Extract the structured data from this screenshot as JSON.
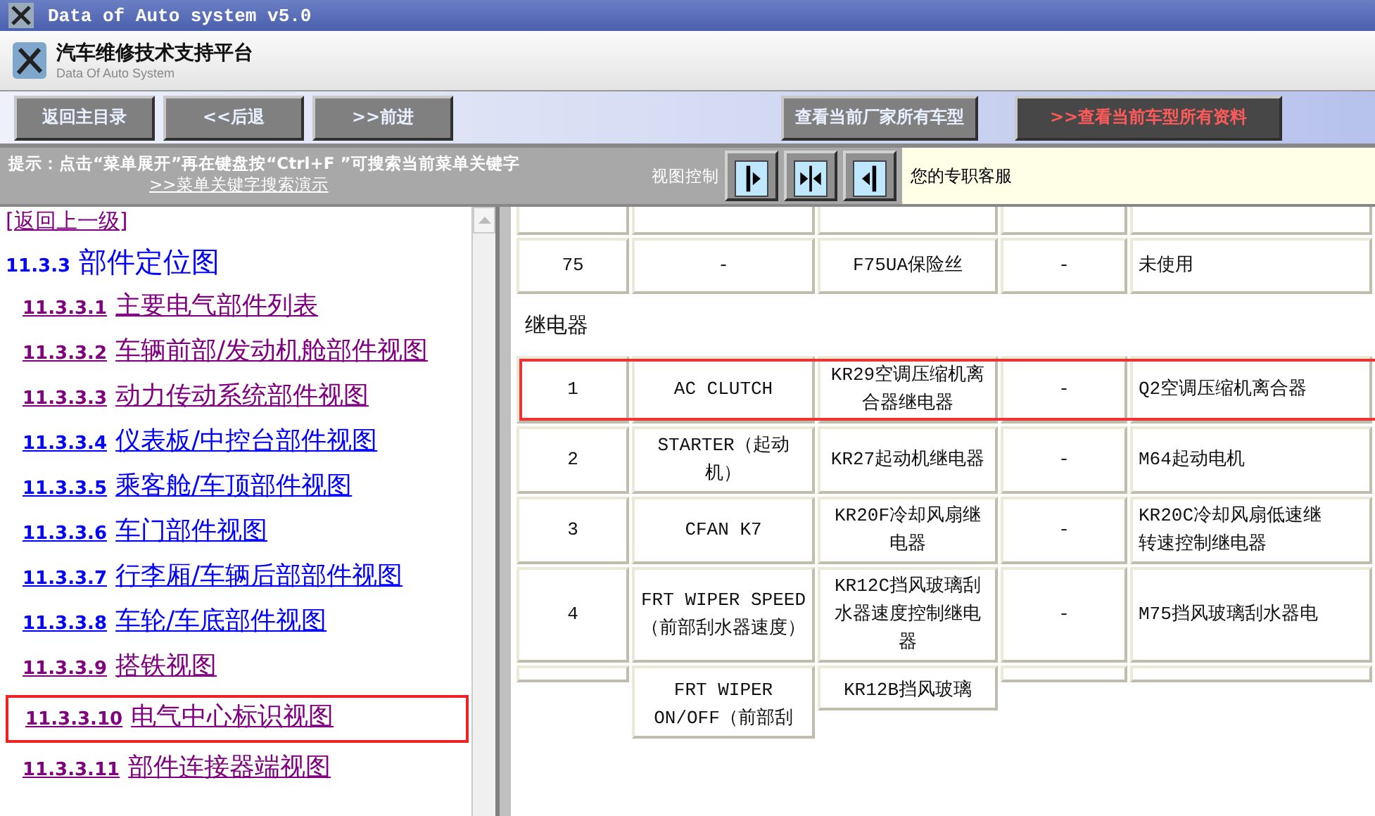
{
  "window": {
    "title": "Data of Auto system v5.0"
  },
  "header": {
    "title": "汽车维修技术支持平台",
    "subtitle": "Data Of Auto System"
  },
  "toolbar": {
    "buttons": [
      {
        "label": "返回主目录"
      },
      {
        "label": "<<后退"
      },
      {
        "label": ">>前进"
      }
    ],
    "right_buttons": [
      {
        "label": "查看当前厂家所有车型",
        "kind": "plain"
      },
      {
        "label": ">>查看当前车型所有资料",
        "kind": "alert"
      }
    ]
  },
  "hint_bar": {
    "hint": "提示：点击“菜单展开”再在键盘按“Ctrl+F ”可搜索当前菜单关键字",
    "demo_link": ">>菜单关键字搜索演示",
    "view_control_label": "视图控制",
    "view_buttons": [
      {
        "kind": "right"
      },
      {
        "kind": "both"
      },
      {
        "kind": "left"
      }
    ],
    "service": "您的专职客服"
  },
  "sidebar": {
    "back_link": "[返回上一级]",
    "heading": {
      "number": "11.3.3",
      "title": "部件定位图"
    },
    "items": [
      {
        "number": "11.3.3.1",
        "title": "主要电气部件列表",
        "visited": true,
        "highlighted": false
      },
      {
        "number": "11.3.3.2",
        "title": "车辆前部/发动机舱部件视图",
        "visited": true,
        "highlighted": false
      },
      {
        "number": "11.3.3.3",
        "title": "动力传动系统部件视图",
        "visited": true,
        "highlighted": false
      },
      {
        "number": "11.3.3.4",
        "title": "仪表板/中控台部件视图",
        "visited": false,
        "highlighted": false
      },
      {
        "number": "11.3.3.5",
        "title": "乘客舱/车顶部件视图",
        "visited": false,
        "highlighted": false
      },
      {
        "number": "11.3.3.6",
        "title": "车门部件视图",
        "visited": false,
        "highlighted": false
      },
      {
        "number": "11.3.3.7",
        "title": "行李厢/车辆后部部件视图",
        "visited": false,
        "highlighted": false
      },
      {
        "number": "11.3.3.8",
        "title": "车轮/车底部件视图",
        "visited": false,
        "highlighted": false
      },
      {
        "number": "11.3.3.9",
        "title": "搭铁视图",
        "visited": true,
        "highlighted": false
      },
      {
        "number": "11.3.3.10",
        "title": "电气中心标识视图",
        "visited": true,
        "highlighted": true
      },
      {
        "number": "11.3.3.11",
        "title": "部件连接器端视图",
        "visited": true,
        "highlighted": false
      }
    ]
  },
  "table": {
    "rows": [
      {
        "kind": "partial",
        "cells": []
      },
      {
        "kind": "row",
        "highlighted": false,
        "cells": [
          "75",
          "-",
          "F75UA保险丝",
          "-",
          "未使用"
        ]
      },
      {
        "kind": "section",
        "title": "继电器"
      },
      {
        "kind": "row",
        "highlighted": true,
        "cells": [
          "1",
          "AC CLUTCH",
          "KR29空调压缩机离合器继电器",
          "-",
          "Q2空调压缩机离合器"
        ]
      },
      {
        "kind": "row",
        "highlighted": false,
        "cells": [
          "2",
          "STARTER（起动机）",
          "KR27起动机继电器",
          "-",
          "M64起动电机"
        ]
      },
      {
        "kind": "row",
        "highlighted": false,
        "cells": [
          "3",
          "CFAN K7",
          "KR20F冷却风扇继电器",
          "-",
          "KR20C冷却风扇低速继转速控制继电器"
        ]
      },
      {
        "kind": "row",
        "highlighted": false,
        "cells": [
          "4",
          "FRT WIPER SPEED（前部刮水器速度）",
          "KR12C挡风玻璃刮水器速度控制继电器",
          "-",
          "M75挡风玻璃刮水器电"
        ]
      },
      {
        "kind": "cut",
        "cells": [
          "",
          "FRT WIPER ON/OFF（前部刮",
          "KR12B挡风玻璃",
          "",
          ""
        ]
      }
    ]
  }
}
